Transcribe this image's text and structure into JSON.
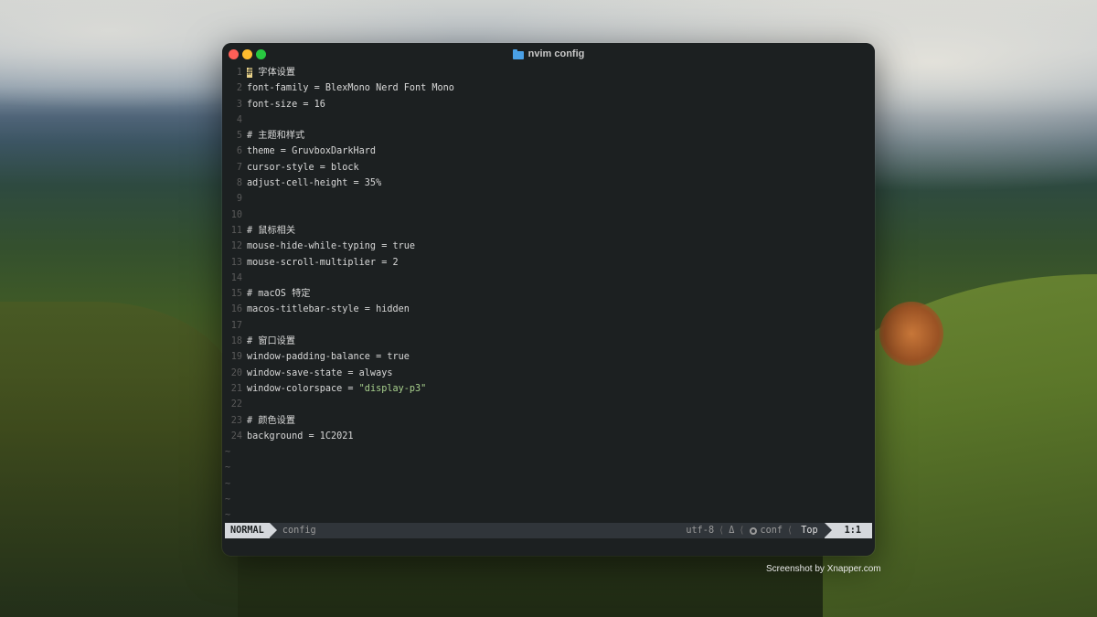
{
  "window": {
    "title": "nvim config",
    "title_icon": "folder-icon"
  },
  "editor": {
    "lines": [
      {
        "n": "1",
        "text": "# 字体设置"
      },
      {
        "n": "2",
        "text": "font-family = BlexMono Nerd Font Mono"
      },
      {
        "n": "3",
        "text": "font-size = 16"
      },
      {
        "n": "4",
        "text": ""
      },
      {
        "n": "5",
        "text": "# 主题和样式"
      },
      {
        "n": "6",
        "text": "theme = GruvboxDarkHard"
      },
      {
        "n": "7",
        "text": "cursor-style = block"
      },
      {
        "n": "8",
        "text": "adjust-cell-height = 35%"
      },
      {
        "n": "9",
        "text": ""
      },
      {
        "n": "10",
        "text": ""
      },
      {
        "n": "11",
        "text": "# 鼠标相关"
      },
      {
        "n": "12",
        "text": "mouse-hide-while-typing = true"
      },
      {
        "n": "13",
        "text": "mouse-scroll-multiplier = 2"
      },
      {
        "n": "14",
        "text": ""
      },
      {
        "n": "15",
        "text": "# macOS 特定"
      },
      {
        "n": "16",
        "text": "macos-titlebar-style = hidden"
      },
      {
        "n": "17",
        "text": ""
      },
      {
        "n": "18",
        "text": "# 窗口设置"
      },
      {
        "n": "19",
        "text": "window-padding-balance = true"
      },
      {
        "n": "20",
        "text": "window-save-state = always"
      },
      {
        "n": "21",
        "text": "window-colorspace = ",
        "string": "\"display-p3\""
      },
      {
        "n": "22",
        "text": ""
      },
      {
        "n": "23",
        "text": "# 颜色设置"
      },
      {
        "n": "24",
        "text": "background = 1C2021"
      }
    ],
    "tilde": "~",
    "tilde_count": 5
  },
  "statusline": {
    "mode": "NORMAL",
    "filename": "config",
    "encoding": "utf-8",
    "delta": "Δ",
    "filetype": "conf",
    "filetype_icon": "gear-icon",
    "scroll": "Top",
    "position": "1:1"
  },
  "watermark": "Screenshot by Xnapper.com",
  "colors": {
    "editor_background": "#1C2021",
    "string": "#a8d08d",
    "cursor": "#e8d28a"
  }
}
